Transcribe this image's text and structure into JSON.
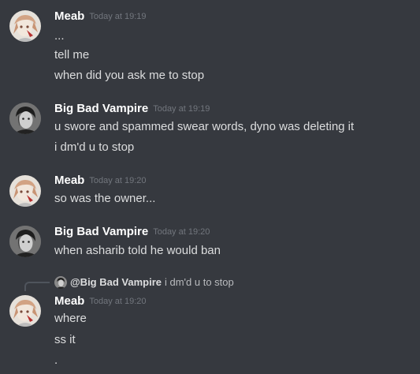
{
  "messages": [
    {
      "author": "Meab",
      "timestamp": "Today at 19:19",
      "lines": [
        "...",
        "tell me",
        "when did you ask me to stop"
      ]
    },
    {
      "author": "Big Bad Vampire",
      "timestamp": "Today at 19:19",
      "lines": [
        "u swore and spammed swear words, dyno was deleting it",
        "i dm'd u to stop"
      ]
    },
    {
      "author": "Meab",
      "timestamp": "Today at 19:20",
      "lines": [
        "so was the owner..."
      ]
    },
    {
      "author": "Big Bad Vampire",
      "timestamp": "Today at 19:20",
      "lines": [
        "when asharib told he would ban"
      ]
    },
    {
      "reply": {
        "author": "@Big Bad Vampire",
        "content": "i dm'd u to stop"
      },
      "author": "Meab",
      "timestamp": "Today at 19:20",
      "lines": [
        "where",
        "ss it",
        "."
      ]
    }
  ],
  "icons": {
    "meab_avatar": "anime-character-avatar",
    "vampire_avatar": "dark-haired-person-avatar"
  },
  "colors": {
    "background": "#36393f",
    "username": "#ffffff",
    "message_text": "#dcddde",
    "timestamp": "#72767d",
    "reply_spine": "#4f545c"
  }
}
